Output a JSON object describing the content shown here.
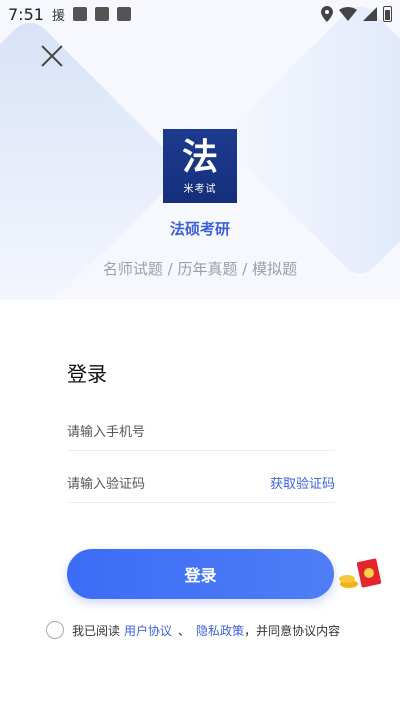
{
  "status_bar": {
    "time": "7:51",
    "app_label": "援",
    "icons": [
      "A-icon",
      "square-icon",
      "square-icon"
    ],
    "right_icons": [
      "location-icon",
      "wifi-icon",
      "signal-icon",
      "battery-icon"
    ]
  },
  "logo": {
    "main_char": "法",
    "sub_text": "米考试"
  },
  "app_name": "法硕考研",
  "tagline": "名师试题 / 历年真题 / 模拟题",
  "login": {
    "title": "登录",
    "phone_placeholder": "请输入手机号",
    "code_placeholder": "请输入验证码",
    "get_code": "获取验证码",
    "button": "登录"
  },
  "agreement": {
    "prefix": "我已阅读",
    "user_agreement": "用户协议",
    "separator": "、",
    "privacy_policy": "隐私政策",
    "suffix": "，并同意协议内容"
  },
  "colors": {
    "accent": "#3b62de",
    "button": "#4a74f6",
    "logo_bg": "#1a378a"
  }
}
